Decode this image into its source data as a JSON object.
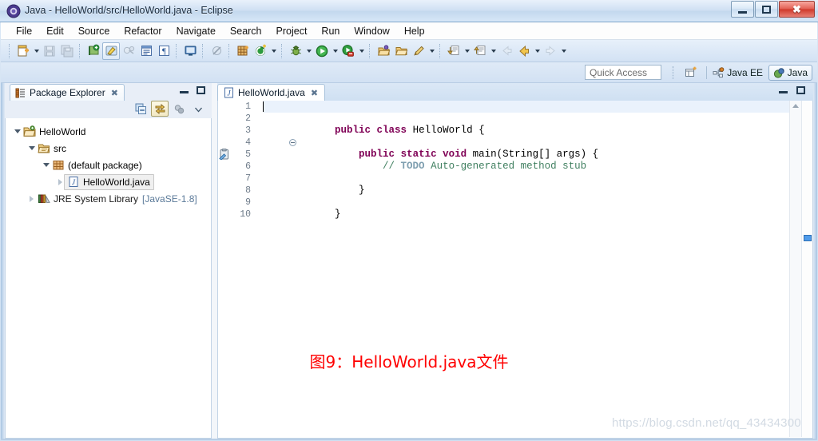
{
  "window": {
    "title": "Java - HelloWorld/src/HelloWorld.java - Eclipse",
    "app_icon": "eclipse-icon",
    "controls": {
      "minimize": "–",
      "maximize": "□",
      "close": "✕"
    }
  },
  "menubar": {
    "items": [
      {
        "label": "File"
      },
      {
        "label": "Edit"
      },
      {
        "label": "Source"
      },
      {
        "label": "Refactor"
      },
      {
        "label": "Navigate"
      },
      {
        "label": "Search"
      },
      {
        "label": "Project"
      },
      {
        "label": "Run"
      },
      {
        "label": "Window"
      },
      {
        "label": "Help"
      }
    ]
  },
  "toolbar": {
    "groups": [
      {
        "buttons": [
          {
            "name": "new-wizard-button",
            "icon": "new-file-icon",
            "enabled": true,
            "dropdown": true
          },
          {
            "name": "save-button",
            "icon": "save-icon",
            "enabled": false
          },
          {
            "name": "save-all-button",
            "icon": "save-all-icon",
            "enabled": false
          }
        ]
      },
      {
        "buttons": [
          {
            "name": "new-java-package-button",
            "icon": "package-new-icon",
            "enabled": true
          },
          {
            "name": "toggle-mark-occurrences-button",
            "icon": "highlighter-icon",
            "enabled": true,
            "selected": true
          },
          {
            "name": "link-build-button",
            "icon": "build-icon",
            "enabled": false
          },
          {
            "name": "open-task-button",
            "icon": "task-list-icon",
            "enabled": true
          },
          {
            "name": "show-whitespace-button",
            "icon": "pilcrow-icon",
            "enabled": true
          }
        ]
      },
      {
        "buttons": [
          {
            "name": "open-console-button",
            "icon": "console-icon",
            "enabled": true
          }
        ]
      },
      {
        "buttons": [
          {
            "name": "skip-breakpoints-button",
            "icon": "skip-breakpoints-icon",
            "enabled": false
          }
        ]
      },
      {
        "buttons": [
          {
            "name": "new-java-class-button",
            "icon": "java-class-new-icon",
            "enabled": true
          },
          {
            "name": "external-tools-button",
            "icon": "external-tools-icon",
            "enabled": true,
            "dropdown": true
          }
        ]
      },
      {
        "buttons": [
          {
            "name": "debug-button",
            "icon": "debug-bug-icon",
            "enabled": true,
            "dropdown": true
          },
          {
            "name": "run-button",
            "icon": "run-play-icon",
            "enabled": true,
            "dropdown": true
          },
          {
            "name": "coverage-button",
            "icon": "coverage-icon",
            "enabled": true,
            "dropdown": true
          }
        ]
      },
      {
        "buttons": [
          {
            "name": "new-package-wizard-button",
            "icon": "open-package-icon",
            "enabled": true
          },
          {
            "name": "open-type-button",
            "icon": "open-folder-icon",
            "enabled": true
          },
          {
            "name": "open-task-editor-button",
            "icon": "pencil-icon",
            "enabled": true,
            "dropdown": true
          }
        ]
      },
      {
        "buttons": [
          {
            "name": "previous-annotation-button",
            "icon": "next-annotation-icon",
            "enabled": true,
            "dropdown": true
          },
          {
            "name": "next-annotation-button",
            "icon": "prev-annotation-icon",
            "enabled": true,
            "dropdown": true
          }
        ]
      },
      {
        "buttons": [
          {
            "name": "back-history-button",
            "icon": "back-arrow-icon",
            "enabled": false
          },
          {
            "name": "back-button",
            "icon": "back-arrow-gold-icon",
            "enabled": true,
            "dropdown": true
          },
          {
            "name": "forward-button",
            "icon": "forward-arrow-icon",
            "enabled": false,
            "dropdown": true
          }
        ]
      }
    ]
  },
  "quick_access": {
    "placeholder": "Quick Access",
    "value": "",
    "open_perspective_icon": "open-perspective-icon",
    "perspectives": [
      {
        "name": "java-ee-perspective",
        "label": "Java EE",
        "icon": "java-ee-icon",
        "active": false
      },
      {
        "name": "java-perspective",
        "label": "Java",
        "icon": "java-icon",
        "active": true
      }
    ]
  },
  "package_explorer": {
    "tab_label": "Package Explorer",
    "tab_icon": "package-explorer-icon",
    "close_icon": "✖",
    "view_buttons": [
      {
        "name": "collapse-all-button",
        "icon": "collapse-all-icon",
        "active": false
      },
      {
        "name": "link-with-editor-button",
        "icon": "link-with-editor-icon",
        "active": true
      },
      {
        "name": "focus-active-task-button",
        "icon": "focus-task-icon",
        "active": false
      },
      {
        "name": "view-menu-button",
        "icon": "chevron-down-icon",
        "active": false
      }
    ],
    "tree": [
      {
        "label": "HelloWorld",
        "icon": "java-project-icon",
        "indent": 0,
        "expanded": true,
        "selected": false
      },
      {
        "label": "src",
        "icon": "source-folder-icon",
        "indent": 1,
        "expanded": true,
        "selected": false
      },
      {
        "label": "(default package)",
        "icon": "package-icon",
        "indent": 2,
        "expanded": true,
        "selected": false
      },
      {
        "label": "HelloWorld.java",
        "icon": "java-file-icon",
        "indent": 3,
        "expanded": false,
        "selected": true
      },
      {
        "label": "JRE System Library",
        "suffix": "[JavaSE-1.8]",
        "icon": "jre-library-icon",
        "indent": 1,
        "expanded": false,
        "selected": false
      }
    ]
  },
  "editor": {
    "tab_label": "HelloWorld.java",
    "tab_icon": "java-file-icon",
    "close_icon": "✖",
    "cursor_line": 1,
    "fold_line": 4,
    "task_marker_line": 5,
    "task_marker_icon": "todo-task-icon",
    "line_numbers": [
      "1",
      "2",
      "3",
      "4",
      "5",
      "6",
      "7",
      "8",
      "9",
      "10"
    ],
    "lines": [
      {
        "n": 1,
        "tokens": []
      },
      {
        "n": 2,
        "tokens": [
          {
            "t": "public",
            "c": "kw"
          },
          {
            "t": " ",
            "c": ""
          },
          {
            "t": "class",
            "c": "kw"
          },
          {
            "t": " HelloWorld {",
            "c": ""
          }
        ]
      },
      {
        "n": 3,
        "tokens": []
      },
      {
        "n": 4,
        "tokens": [
          {
            "t": "    ",
            "c": ""
          },
          {
            "t": "public",
            "c": "kw"
          },
          {
            "t": " ",
            "c": ""
          },
          {
            "t": "static",
            "c": "kw"
          },
          {
            "t": " ",
            "c": ""
          },
          {
            "t": "void",
            "c": "kw"
          },
          {
            "t": " main(String[] args) {",
            "c": ""
          }
        ]
      },
      {
        "n": 5,
        "tokens": [
          {
            "t": "        ",
            "c": ""
          },
          {
            "t": "// ",
            "c": "cm"
          },
          {
            "t": "TODO",
            "c": "todo"
          },
          {
            "t": " Auto-generated method stub",
            "c": "cm"
          }
        ]
      },
      {
        "n": 6,
        "tokens": []
      },
      {
        "n": 7,
        "tokens": [
          {
            "t": "    }",
            "c": ""
          }
        ]
      },
      {
        "n": 8,
        "tokens": []
      },
      {
        "n": 9,
        "tokens": [
          {
            "t": "}",
            "c": ""
          }
        ]
      },
      {
        "n": 10,
        "tokens": []
      }
    ]
  },
  "caption": {
    "text": "图9：HelloWorld.java文件",
    "color": "#ff0000"
  },
  "watermark": {
    "text": "https://blog.csdn.net/qq_43434300"
  },
  "colors": {
    "keyword": "#7f0055",
    "comment": "#3f7f5f",
    "todo": "#7f9fb0",
    "selection": "#f0f0f0",
    "current_line": "#eaf2fc",
    "library_suffix": "#5b7a99"
  }
}
